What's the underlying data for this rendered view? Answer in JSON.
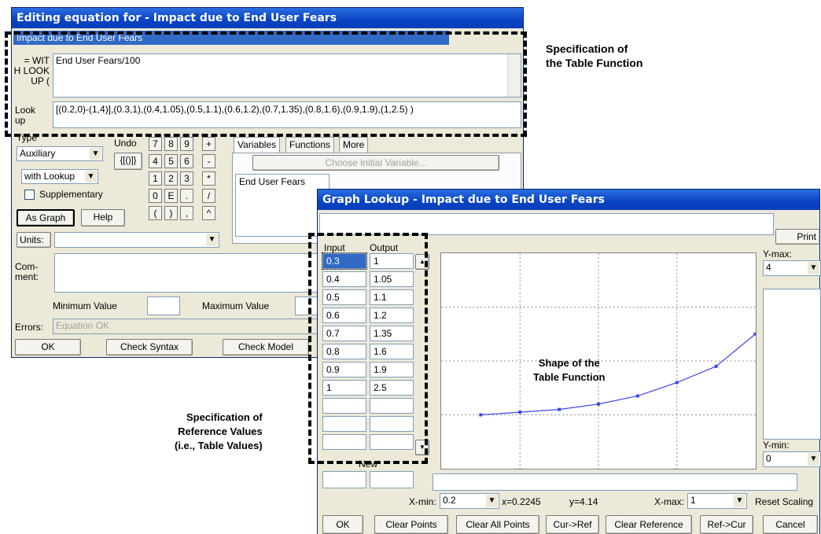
{
  "equation_window": {
    "title": "Editing equation for - Impact due to End User Fears",
    "name_field": "Impact due to End User Fears",
    "eq_label": "= WIT\nH LOOK\nUP (",
    "equation": "End User Fears/100",
    "lookup_label": "Look\nup",
    "lookup_value": "[(0.2,0)-(1,4)],(0.3,1),(0.4,1.05),(0.5,1.1),(0.6,1.2),(0.7,1.35),(0.8,1.6),(0.9,1.9),(1,2.5) )",
    "type_label": "Type",
    "type_value": "Auxiliary",
    "subtype_value": "with Lookup",
    "supplementary_label": "Supplementary",
    "as_graph": "As Graph",
    "help": "Help",
    "undo": "Undo",
    "brackets": "{[()]}",
    "keypad": [
      "7",
      "8",
      "9",
      "+",
      "4",
      "5",
      "6",
      "-",
      "1",
      "2",
      "3",
      "*",
      "0",
      "E",
      ".",
      "/",
      "(",
      ")",
      ",",
      "^"
    ],
    "tabs": [
      "Variables",
      "Functions",
      "More"
    ],
    "choose_initial": "Choose Initial Variable...",
    "variables_list": [
      "End User Fears"
    ],
    "units_label": "Units:",
    "comment_label": "Com-\nment:",
    "min_label": "Minimum Value",
    "max_label": "Maximum Value",
    "errors_label": "Errors:",
    "errors_value": "Equation OK",
    "ok": "OK",
    "check_syntax": "Check Syntax",
    "check_model": "Check Model"
  },
  "graph_window": {
    "title": "Graph Lookup - Impact due to End User Fears",
    "print": "Print",
    "input_header": "Input",
    "output_header": "Output",
    "new_label": "New",
    "ymax_label": "Y-max:",
    "ymax_value": "4",
    "ymin_label": "Y-min:",
    "ymin_value": "0",
    "xmin_label": "X-min:",
    "xmin_value": "0.2",
    "cursor_x": "x=0.2245",
    "cursor_y": "y=4.14",
    "xmax_label": "X-max:",
    "xmax_value": "1",
    "reset_scaling": "Reset Scaling",
    "buttons": [
      "OK",
      "Clear Points",
      "Clear All Points",
      "Cur->Ref",
      "Clear Reference",
      "Ref->Cur",
      "Cancel"
    ]
  },
  "chart_data": {
    "type": "line",
    "x": [
      0.3,
      0.4,
      0.5,
      0.6,
      0.7,
      0.8,
      0.9,
      1
    ],
    "y": [
      1,
      1.05,
      1.1,
      1.2,
      1.35,
      1.6,
      1.9,
      2.5
    ],
    "xlim": [
      0.2,
      1
    ],
    "ylim": [
      0,
      4
    ],
    "grid": true,
    "line_color": "#3b47e8"
  },
  "table_rows": [
    {
      "input": "0.3",
      "output": "1"
    },
    {
      "input": "0.4",
      "output": "1.05"
    },
    {
      "input": "0.5",
      "output": "1.1"
    },
    {
      "input": "0.6",
      "output": "1.2"
    },
    {
      "input": "0.7",
      "output": "1.35"
    },
    {
      "input": "0.8",
      "output": "1.6"
    },
    {
      "input": "0.9",
      "output": "1.9"
    },
    {
      "input": "1",
      "output": "2.5"
    },
    {
      "input": "",
      "output": ""
    },
    {
      "input": "",
      "output": ""
    },
    {
      "input": "",
      "output": ""
    }
  ],
  "annotations": {
    "spec_table_function": "Specification of\nthe Table Function",
    "shape_table_function": "Shape of the\nTable Function",
    "spec_reference_values": "Specification of\nReference Values\n(i.e., Table Values)"
  }
}
